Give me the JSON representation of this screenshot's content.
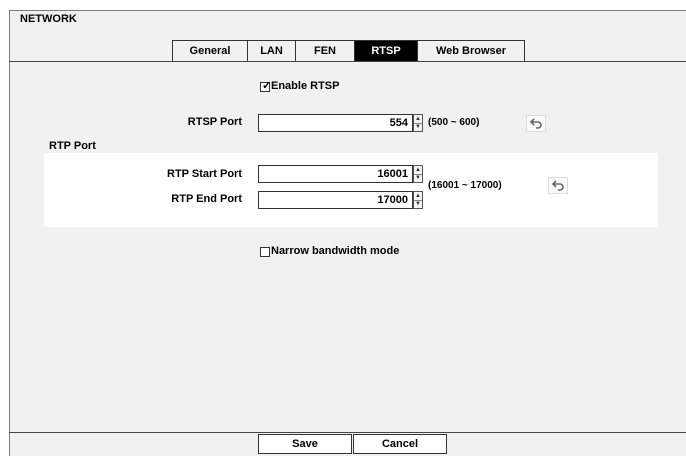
{
  "window": {
    "title": "NETWORK"
  },
  "tabs": [
    "General",
    "LAN",
    "FEN",
    "RTSP",
    "Web Browser"
  ],
  "active_tab": "RTSP",
  "enable_rtsp": {
    "label": "Enable RTSP",
    "checked": true
  },
  "rtsp_port": {
    "label": "RTSP Port",
    "value": "554",
    "range": "(500 ~ 600)"
  },
  "rtp": {
    "section_label": "RTP Port",
    "start": {
      "label": "RTP Start Port",
      "value": "16001"
    },
    "end": {
      "label": "RTP End Port",
      "value": "17000"
    },
    "range": "(16001 ~ 17000)"
  },
  "narrow_bandwidth": {
    "label": "Narrow bandwidth mode",
    "checked": false
  },
  "buttons": {
    "save": "Save",
    "cancel": "Cancel"
  },
  "icons": {
    "reset": "undo-icon",
    "spin_up": "arrow-up-icon",
    "spin_down": "arrow-down-icon"
  }
}
